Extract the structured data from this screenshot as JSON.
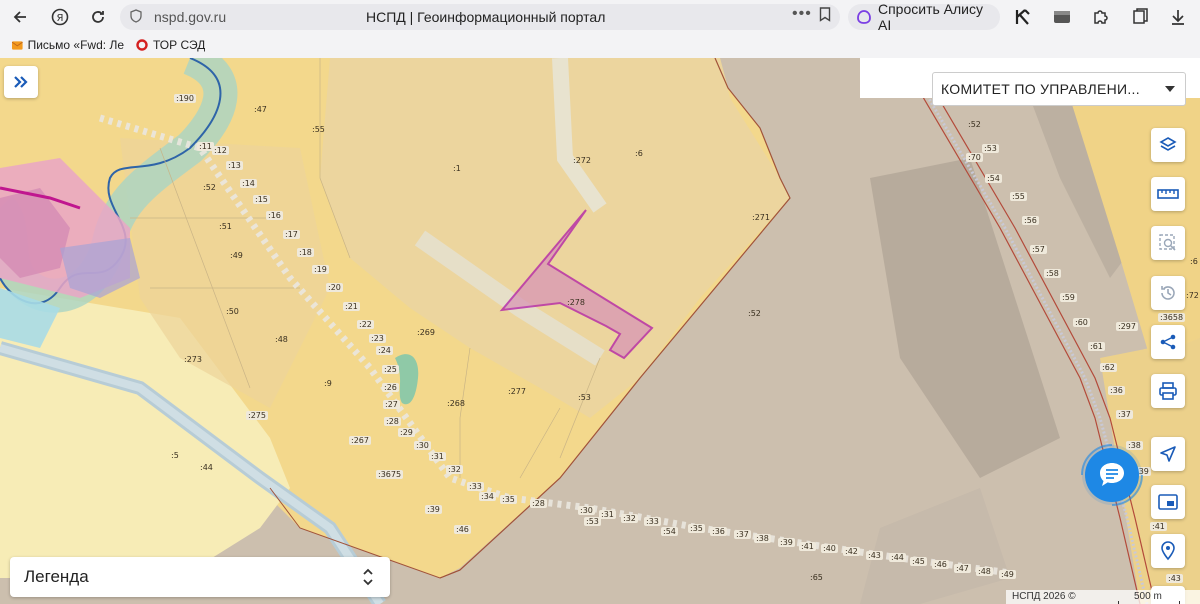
{
  "browser": {
    "url": "nspd.gov.ru",
    "title": "НСПД | Геоинформационный портал",
    "alice_label": "Спросить Алису AI"
  },
  "bookmarks": [
    {
      "label": "Письмо «Fwd: Ле"
    },
    {
      "label": "ТОР СЭД"
    }
  ],
  "map": {
    "layer_select": "КОМИТЕТ ПО УПРАВЛЕНИ...",
    "legend_label": "Легенда",
    "attribution": "НСПД 2026 ©",
    "scale_label": "500 m",
    "highlight_color": "#b01aa8",
    "parcel_labels": [
      ":190",
      ":47",
      ":55",
      ":11",
      ":12",
      ":13",
      ":52",
      ":14",
      ":15",
      ":16",
      ":51",
      ":17",
      ":49",
      ":18",
      ":19",
      ":20",
      ":50",
      ":21",
      ":22",
      ":48",
      ":23",
      ":24",
      ":25",
      ":9",
      ":26",
      ":27",
      ":275",
      ":28",
      ":29",
      ":267",
      ":30",
      ":31",
      ":32",
      ":3675",
      ":33",
      ":34",
      ":35",
      ":39",
      ":46",
      ":28",
      ":30",
      ":31",
      ":53",
      ":32",
      ":33",
      ":54",
      ":35",
      ":36",
      ":37",
      ":38",
      ":39",
      ":41",
      ":40",
      ":42",
      ":43",
      ":44",
      ":45",
      ":46",
      ":47",
      ":48",
      ":49",
      ":65",
      ":272",
      ":6",
      ":1",
      ":271",
      ":278",
      ":52",
      ":269",
      ":268",
      ":277",
      ":53",
      ":273",
      ":44",
      ":5",
      ":52",
      ":53",
      ":70",
      ":54",
      ":55",
      ":56",
      ":57",
      ":58",
      ":59",
      ":60",
      ":61",
      ":62",
      ":297",
      ":36",
      ":37",
      ":38",
      ":39",
      ":41",
      ":43",
      ":72",
      ":3658",
      ":6"
    ]
  },
  "icons": {
    "expand": "double-chevron-right-icon",
    "layers": "layers-icon",
    "ruler": "ruler-icon",
    "select": "area-select-icon",
    "history": "history-icon",
    "share": "share-icon",
    "print": "print-icon",
    "locate": "locate-icon",
    "window": "window-icon",
    "geo": "geo-search-icon",
    "chat": "chat-icon"
  }
}
